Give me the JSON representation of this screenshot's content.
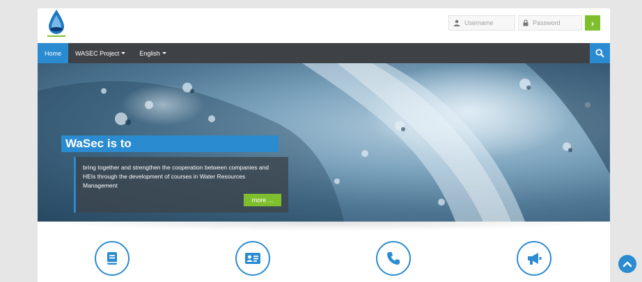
{
  "header": {
    "username_placeholder": "Username",
    "password_placeholder": "Password",
    "login_icon": "chevron-right-icon"
  },
  "nav": {
    "items": [
      {
        "label": "Home",
        "active": true
      },
      {
        "label": "WASEC Project",
        "dropdown": true
      },
      {
        "label": "English",
        "dropdown": true
      }
    ],
    "search_icon": "search-icon"
  },
  "hero": {
    "title": "WaSec is to",
    "text": "bring together and strengthen the cooperation between companies and HEIs through the development of courses in Water Resources Management",
    "more_label": "more ..."
  },
  "features": [
    {
      "icon": "book-icon"
    },
    {
      "icon": "id-card-icon"
    },
    {
      "icon": "phone-icon"
    },
    {
      "icon": "megaphone-icon"
    }
  ],
  "colors": {
    "accent": "#2a8bd0",
    "green": "#7fbf2d",
    "navbar": "#3e4246"
  }
}
